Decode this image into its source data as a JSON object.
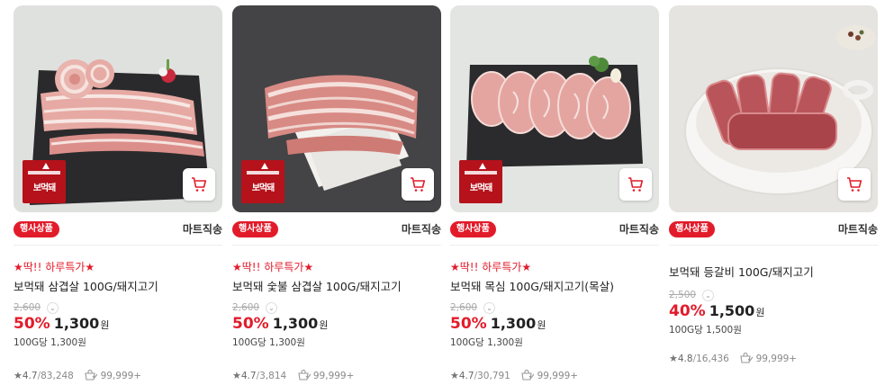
{
  "colors": {
    "accent": "#e21b2a",
    "brand_logo": "#b5121b"
  },
  "icons": {
    "cart": "cart-icon",
    "star": "star-icon",
    "sold": "sold-count-icon",
    "chevron": "chevron-down-icon"
  },
  "products": [
    {
      "event_badge": "행사상품",
      "shipping": "마트직송",
      "promo": "★딱!! 하루특가★",
      "title": "보먹돼 삼겹살 100G/돼지고기",
      "original_price": "2,600",
      "discount": "50%",
      "price": "1,300",
      "won": "원",
      "unit_price": "100G당 1,300원",
      "rating": "4.7",
      "reviews": "83,248",
      "sold": "99,999+",
      "logo_text": "보먹돼"
    },
    {
      "event_badge": "행사상품",
      "shipping": "마트직송",
      "promo": "★딱!! 하루특가★",
      "title": "보먹돼 숯불 삼겹살 100G/돼지고기",
      "original_price": "2,600",
      "discount": "50%",
      "price": "1,300",
      "won": "원",
      "unit_price": "100G당 1,300원",
      "rating": "4.7",
      "reviews": "3,814",
      "sold": "99,999+",
      "logo_text": "보먹돼"
    },
    {
      "event_badge": "행사상품",
      "shipping": "마트직송",
      "promo": "★딱!! 하루특가★",
      "title": "보먹돼 목심 100G/돼지고기(목살)",
      "original_price": "2,600",
      "discount": "50%",
      "price": "1,300",
      "won": "원",
      "unit_price": "100G당 1,300원",
      "rating": "4.7",
      "reviews": "30,791",
      "sold": "99,999+",
      "logo_text": "보먹돼"
    },
    {
      "event_badge": "행사상품",
      "shipping": "마트직송",
      "promo": "",
      "title": "보먹돼 등갈비 100G/돼지고기",
      "original_price": "2,500",
      "discount": "40%",
      "price": "1,500",
      "won": "원",
      "unit_price": "100G당 1,500원",
      "rating": "4.8",
      "reviews": "16,436",
      "sold": "99,999+",
      "logo_text": ""
    }
  ]
}
